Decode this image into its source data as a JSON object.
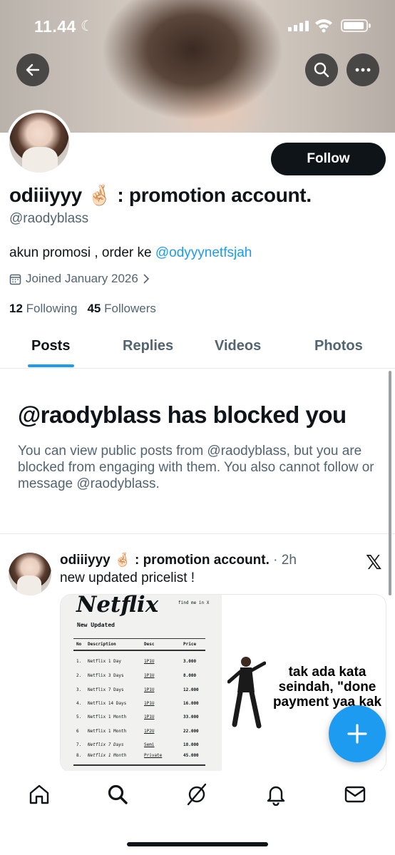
{
  "status_bar": {
    "time": "11.44",
    "moon": "☾"
  },
  "profile": {
    "follow_label": "Follow",
    "display_name": "odiiiyyy 🤞🏻 : promotion account.",
    "handle": "@raodyblass",
    "bio_text": "akun promosi , order ke ",
    "bio_mention": "@odyyynetfsjah",
    "joined": "Joined January 2026",
    "following_count": "12",
    "following_label": "Following",
    "followers_count": "45",
    "followers_label": "Followers"
  },
  "tabs": [
    "Posts",
    "Replies",
    "Videos",
    "Photos"
  ],
  "blocked": {
    "title": "@raodyblass has blocked you",
    "text": "You can view public posts from @raodyblass, but you are blocked from engaging with them. You also cannot follow or message @raodyblass."
  },
  "post": {
    "name": "odiiiyyy 🤞🏻 : promotion account.",
    "time": " · 2h",
    "text": "new updated pricelist !",
    "x_logo": "𝕏",
    "pricelist": {
      "brand": "Netflix",
      "find_me": "find me in X",
      "subtitle": "New Updated",
      "headers": [
        "No",
        "Description",
        "Desc",
        "Price"
      ],
      "rows": [
        [
          "1.",
          "Netflix 1 Day",
          "1P1U",
          "3.000"
        ],
        [
          "2.",
          "Netflix 3 Days",
          "1P1U",
          "8.000"
        ],
        [
          "3.",
          "Netflix 7 Days",
          "1P1U",
          "12.000"
        ],
        [
          "4.",
          "Netflix 14 Days",
          "1P1U",
          "16.000"
        ],
        [
          "5.",
          "Netflix 1 Month",
          "1P1U",
          "33.000"
        ],
        [
          "6",
          "Netflix 1 Month",
          "1P2U",
          "22.000"
        ],
        [
          "7.",
          "Netflix 7 Days",
          "Semi",
          "18.000"
        ],
        [
          "8.",
          "Netflix 1 Month",
          "Private",
          "45.000"
        ]
      ]
    },
    "meme_caption_1": "tak ada kata",
    "meme_caption_2": "seindah, \"done",
    "meme_caption_3": "payment yaa kak"
  },
  "icons": {
    "back": "back-arrow-icon",
    "search": "search-icon",
    "more": "more-icon",
    "calendar": "calendar-icon",
    "nav": [
      "home-icon",
      "search-icon",
      "grok-icon",
      "notifications-icon",
      "messages-icon"
    ]
  },
  "colors": {
    "accent": "#1d9bf0",
    "text": "#0f1419",
    "muted": "#536471"
  }
}
